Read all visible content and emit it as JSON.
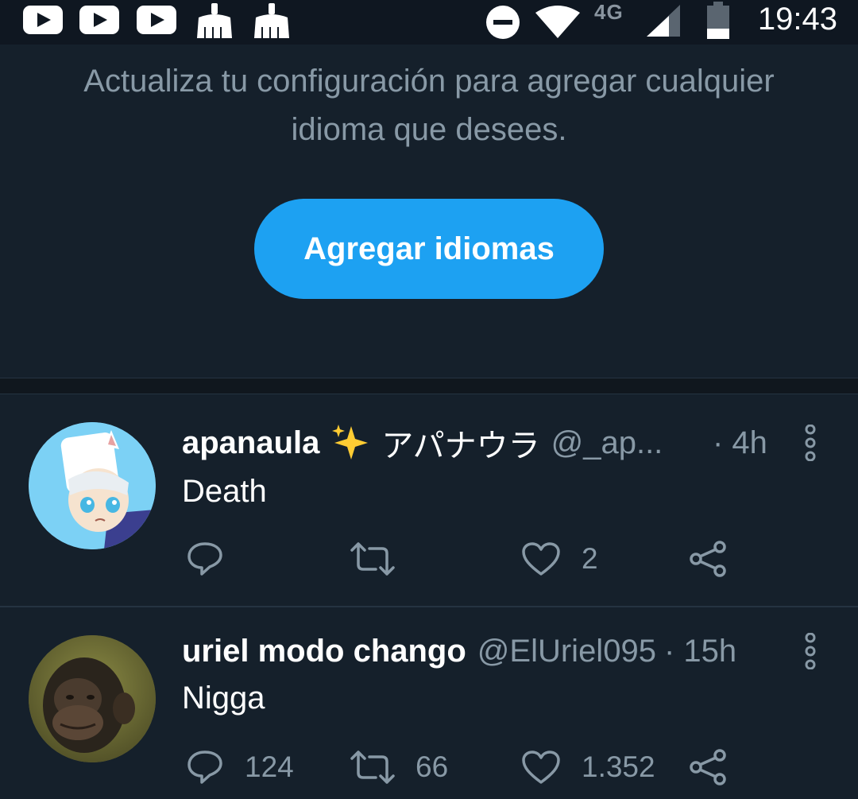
{
  "status_bar": {
    "time": "19:43",
    "network": "4G",
    "icons": [
      "youtube-icon",
      "youtube-icon",
      "youtube-icon",
      "cleaner-icon",
      "cleaner-icon",
      "do-not-disturb-icon",
      "wifi-icon",
      "signal-icon",
      "battery-icon"
    ]
  },
  "language_prompt": {
    "message_line1": "Actualiza tu configuración para agregar cualquier",
    "message_line2": "idioma que desees.",
    "button_label": "Agregar idiomas",
    "button_color": "#1da1f2"
  },
  "tweets": [
    {
      "display_name": "apanaula",
      "name_suffix": "アパナウラ",
      "emoji": "sparkles-icon",
      "handle": "@_ap...",
      "time": "· 4h",
      "text": "Death",
      "reply_count": "",
      "retweet_count": "",
      "like_count": "2"
    },
    {
      "display_name": "uriel modo chango",
      "handle": "@ElUriel095",
      "time": "· 15h",
      "text": "Nigga",
      "reply_count": "124",
      "retweet_count": "66",
      "like_count": "1.352"
    }
  ],
  "colors": {
    "background": "#15202b",
    "secondary_text": "#8899a6",
    "accent": "#1da1f2"
  }
}
